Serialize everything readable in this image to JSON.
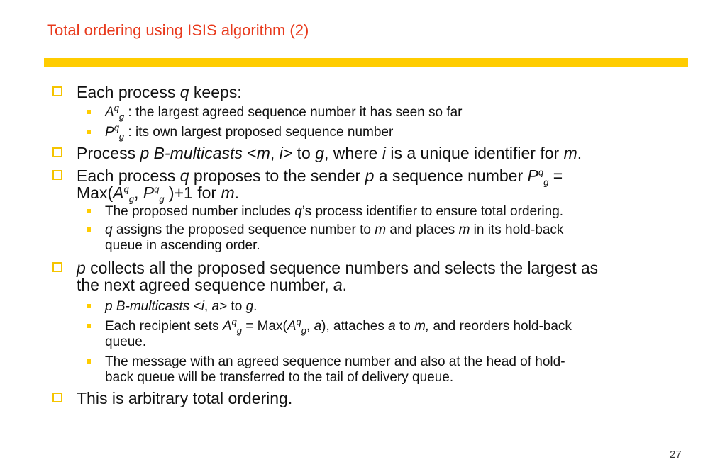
{
  "slide": {
    "title": "Total ordering using ISIS algorithm (2)",
    "page_number": "27"
  },
  "bullets": {
    "b1": {
      "pre": "Each process ",
      "q": "q",
      "post": " keeps:"
    },
    "b1s1": {
      "A": "A",
      "q": "q",
      "g": "g",
      "post": " : the largest agreed sequence number it has seen so far"
    },
    "b1s2": {
      "P": "P",
      "q": "q",
      "g": "g",
      "post": " : its own largest proposed sequence number"
    },
    "b2": {
      "p": "Process ",
      "pi": "p B-multicasts",
      "t1": " <",
      "m": "m",
      "t2": ", ",
      "i": "i",
      "t3": "> to ",
      "g": "g",
      "t4": ", where ",
      "i2": "i",
      "t5": " is a unique identifier for ",
      "m2": "m",
      "t6": "."
    },
    "b3": {
      "t1": "Each process ",
      "q": "q",
      "t2": " proposes to the sender ",
      "p": "p",
      "t3": " a sequence number ",
      "P": "P",
      "q2": "q",
      "g": "g",
      "t4": " =",
      "t5": "Max(",
      "A": "A",
      "q3": "q",
      "g2": "g",
      "t6": ", ",
      "P2": "P",
      "q4": "q",
      "g3": "g",
      "t7": " )+1 for ",
      "m": "m",
      "t8": "."
    },
    "b3s1": {
      "t1": "The proposed number includes ",
      "q": "q",
      "t2": "’s process identifier to ensure total ordering."
    },
    "b3s2": {
      "q": "q",
      "t1": " assigns the proposed sequence number to ",
      "m": "m",
      "t2": " and places ",
      "m2": "m",
      "t3": " in its hold-back",
      "t4": "queue in ascending order."
    },
    "b4": {
      "p": "p",
      "t1": " collects all the proposed sequence numbers and selects the largest as",
      "t2": "the next agreed sequence number, ",
      "a": "a",
      "t3": "."
    },
    "b4s1": {
      "pi": " p B-multicasts",
      "t1": " <",
      "i": "i",
      "t2": ", ",
      "a": "a",
      "t3": "> to ",
      "g": "g",
      "t4": "."
    },
    "b4s2": {
      "t1": "Each recipient sets ",
      "A": "A",
      "q": "q",
      "g": "g",
      "t2": " = Max(",
      "A2": "A",
      "q2": "q",
      "g2": "g",
      "t3": ", ",
      "a": "a",
      "t4": "), attaches ",
      "a2": "a",
      "t5": " to ",
      "m": "m,",
      "t6": " and reorders hold-back",
      "t7": "queue."
    },
    "b4s3": {
      "t1": "The message with an agreed sequence number and also at the head of hold-",
      "t2": "back queue will be transferred to the tail of delivery queue."
    },
    "b5": {
      "t1": "This is arbitrary total ordering."
    }
  },
  "colors": {
    "title": "#e8391c",
    "rule": "#ffcc00",
    "bullet": "#ffcc00",
    "text": "#111111"
  }
}
